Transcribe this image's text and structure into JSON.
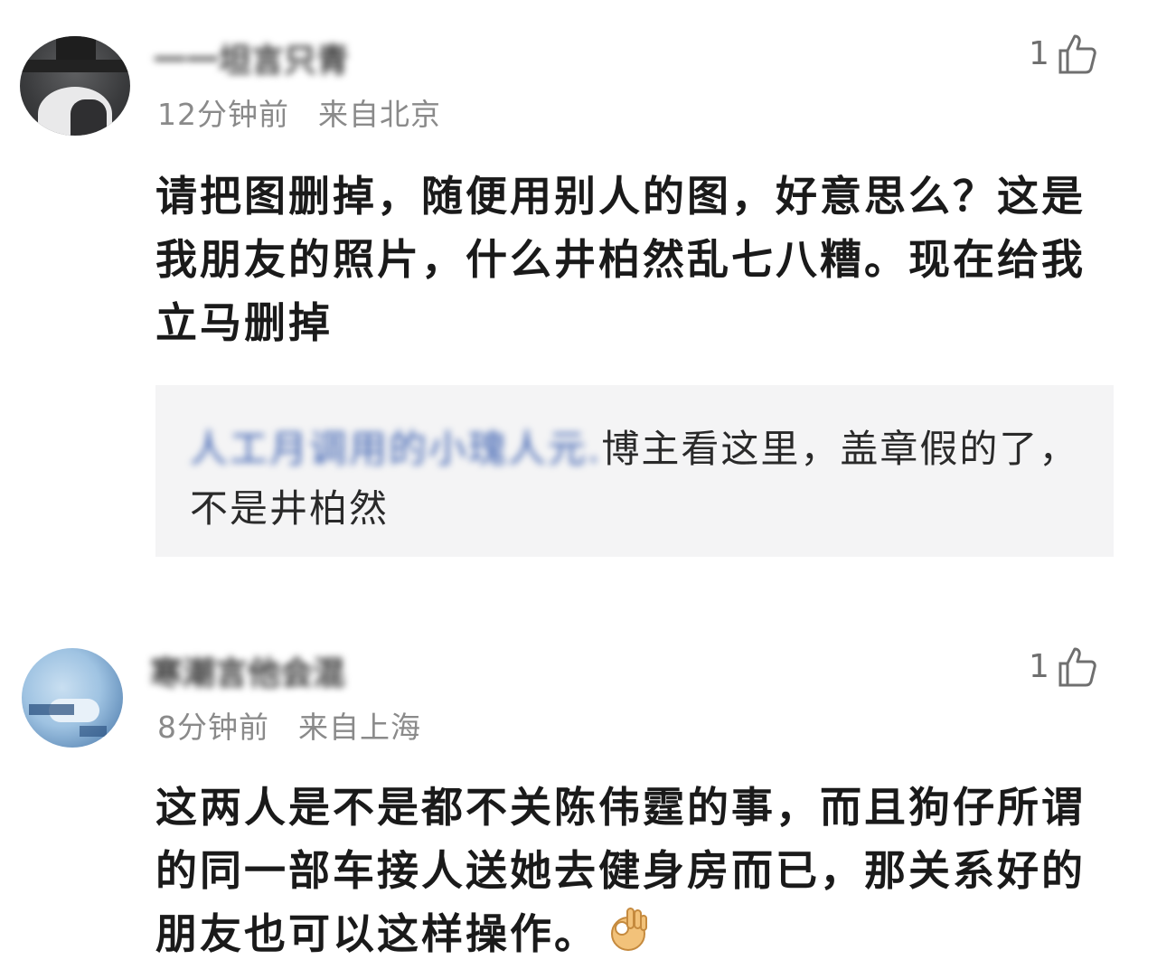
{
  "comments": [
    {
      "username": "一一坦言只青",
      "time": "12分钟前",
      "location": "来自北京",
      "likes": "1",
      "text": "请把图删掉，随便用别人的图，好意思么？这是我朋友的照片，什么井柏然乱七八糟。现在给我立马删掉",
      "quote": {
        "author_blurred": "人工月调用的小瑰人元.",
        "text": "博主看这里，盖章假的了，不是井柏然"
      }
    },
    {
      "username": "寒潮言他会混",
      "time": "8分钟前",
      "location": "来自上海",
      "likes": "1",
      "text": "这两人是不是都不关陈伟霆的事，而且狗仔所谓的同一部车接人送她去健身房而已，那关系好的朋友也可以这样操作。",
      "emoji": "ok-hand-icon"
    }
  ]
}
